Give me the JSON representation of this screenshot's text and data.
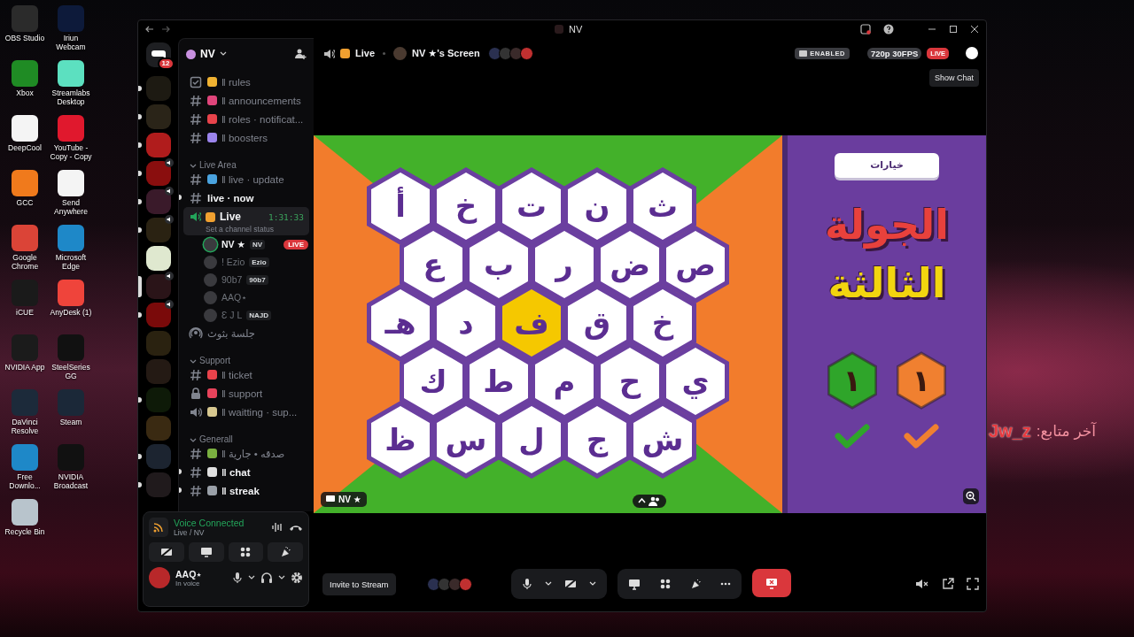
{
  "desktop": {
    "icons": [
      {
        "label": "OBS Studio",
        "color": "#2b2b2b"
      },
      {
        "label": "Iriun Webcam",
        "color": "#0d1a3a"
      },
      {
        "label": "Xbox",
        "color": "#1f8b24"
      },
      {
        "label": "Streamlabs Desktop",
        "color": "#5ce0c0"
      },
      {
        "label": "DeepCool",
        "color": "#f4f4f4"
      },
      {
        "label": "YouTube - Copy - Copy",
        "color": "#e0182d"
      },
      {
        "label": "GCC",
        "color": "#f07a1c"
      },
      {
        "label": "Send Anywhere",
        "color": "#f4f4f4"
      },
      {
        "label": "Google Chrome",
        "color": "#db4437"
      },
      {
        "label": "Microsoft Edge",
        "color": "#1e88c8"
      },
      {
        "label": "iCUE",
        "color": "#1a1a1a"
      },
      {
        "label": "AnyDesk (1)",
        "color": "#ef443b"
      },
      {
        "label": "NVIDIA App",
        "color": "#1b1b1b"
      },
      {
        "label": "SteelSeries GG",
        "color": "#111111"
      },
      {
        "label": "DaVinci Resolve",
        "color": "#1c2a3a"
      },
      {
        "label": "Steam",
        "color": "#1b2838"
      },
      {
        "label": "Free Downlo...",
        "color": "#1e88c8"
      },
      {
        "label": "NVIDIA Broadcast",
        "color": "#111111"
      },
      {
        "label": "Recycle Bin",
        "color": "#b8c4cc"
      }
    ],
    "follower_label": "آخر متابع:",
    "follower_name": "Jw_z"
  },
  "window": {
    "title": "NV"
  },
  "servers": {
    "home_badge": "12",
    "items": [
      {
        "color": "#1d1a12",
        "voice": false,
        "unread": true,
        "selected": false
      },
      {
        "color": "#2a2418",
        "voice": false,
        "unread": true,
        "selected": false
      },
      {
        "color": "#b01c1c",
        "voice": false,
        "unread": true,
        "selected": false
      },
      {
        "color": "#8a0e0e",
        "voice": true,
        "unread": true,
        "selected": false
      },
      {
        "color": "#3a1a2a",
        "voice": true,
        "unread": true,
        "selected": false
      },
      {
        "color": "#2a2212",
        "voice": true,
        "unread": true,
        "selected": false
      },
      {
        "color": "#dfe8cf",
        "voice": false,
        "unread": false,
        "selected": false
      },
      {
        "color": "#2a1418",
        "voice": true,
        "unread": false,
        "selected": true
      },
      {
        "color": "#7a0a0a",
        "voice": true,
        "unread": true,
        "selected": false
      },
      {
        "color": "#2a2210",
        "voice": false,
        "unread": false,
        "selected": false
      },
      {
        "color": "#241a14",
        "voice": false,
        "unread": false,
        "selected": false
      },
      {
        "color": "#0e1a08",
        "voice": false,
        "unread": true,
        "selected": false
      },
      {
        "color": "#3a2a12",
        "voice": false,
        "unread": false,
        "selected": false
      },
      {
        "color": "#1c2430",
        "voice": false,
        "unread": true,
        "selected": false
      },
      {
        "color": "#201a1c",
        "voice": false,
        "unread": true,
        "selected": false
      }
    ]
  },
  "sidebar": {
    "server_name": "NV",
    "channels": [
      {
        "kind": "rules",
        "color": "#f0b232",
        "name": "‖ rules",
        "unread": false
      },
      {
        "kind": "text",
        "color": "#e0457b",
        "name": "‖ announcements",
        "unread": false
      },
      {
        "kind": "text",
        "color": "#e8434b",
        "name": "‖ roles · notificat...",
        "unread": false
      },
      {
        "kind": "text",
        "color": "#9b84ec",
        "name": "‖ boosters",
        "unread": false
      },
      {
        "kind": "category",
        "name": "Live Area"
      },
      {
        "kind": "text",
        "color": "#4aa3df",
        "name": "‖ live · update",
        "unread": false
      },
      {
        "kind": "text",
        "name": "live · now",
        "unread": true
      },
      {
        "kind": "voice_live",
        "color": "#f0a030",
        "name": "Live",
        "timer": "1:31:33",
        "status_hint": "Set a channel status",
        "selected": true,
        "members": [
          {
            "name": "NV ★",
            "tag": "NV",
            "badge": "LIVE",
            "speaking": true
          },
          {
            "name": "! Ezio",
            "tag": "Ezio",
            "speaking": false
          },
          {
            "name": "90b7",
            "tag": "90b7",
            "speaking": false
          },
          {
            "name": "AAQ⋆",
            "speaking": false
          },
          {
            "name": "Ɛ J L",
            "tag": "NAJD",
            "speaking": false
          }
        ]
      },
      {
        "kind": "stage",
        "name": "جلسة بثوث",
        "unread": false
      },
      {
        "kind": "category",
        "name": "Support"
      },
      {
        "kind": "text",
        "color": "#e8434b",
        "name": "‖ ticket",
        "unread": false
      },
      {
        "kind": "locked",
        "color": "#e8435b",
        "name": "‖ support",
        "unread": false
      },
      {
        "kind": "voice",
        "color": "#d8c890",
        "name": "‖ waitting · sup...",
        "unread": false
      },
      {
        "kind": "category",
        "name": "Generall"
      },
      {
        "kind": "text",
        "color": "#7ab040",
        "name": "‖ صدقه • جارية",
        "unread": false
      },
      {
        "kind": "text",
        "color": "#e0e0e0",
        "name": "‖ chat",
        "unread": true
      },
      {
        "kind": "text",
        "color": "#9aa0a8",
        "name": "‖ streak",
        "unread": true
      }
    ]
  },
  "voice_panel": {
    "status": "Voice Connected",
    "location": "Live / NV",
    "user_name": "AAQ⋆",
    "user_status": "In voice"
  },
  "stream_header": {
    "channel": "Live",
    "screen_title": "NV ★'s Screen",
    "badge": "ENABLED",
    "quality": "720p 30FPS",
    "live": "LIVE",
    "tooltip": "Show Chat"
  },
  "stream": {
    "presenter": "NV ★",
    "tiles": [
      [
        {
          "letter": "ث",
          "highlighted": false
        },
        {
          "letter": "ن",
          "highlighted": false
        },
        {
          "letter": "ت",
          "highlighted": false
        },
        {
          "letter": "خ",
          "highlighted": false
        },
        {
          "letter": "أ",
          "highlighted": false
        }
      ],
      [
        {
          "letter": "ص",
          "highlighted": false
        },
        {
          "letter": "ض",
          "highlighted": false
        },
        {
          "letter": "ر",
          "highlighted": false
        },
        {
          "letter": "ب",
          "highlighted": false
        },
        {
          "letter": "ع",
          "highlighted": false
        }
      ],
      [
        {
          "letter": "خ",
          "highlighted": false
        },
        {
          "letter": "ق",
          "highlighted": false
        },
        {
          "letter": "ف",
          "highlighted": true
        },
        {
          "letter": "د",
          "highlighted": false
        },
        {
          "letter": "هـ",
          "highlighted": false
        }
      ],
      [
        {
          "letter": "ي",
          "highlighted": false
        },
        {
          "letter": "ح",
          "highlighted": false
        },
        {
          "letter": "م",
          "highlighted": false
        },
        {
          "letter": "ط",
          "highlighted": false
        },
        {
          "letter": "ك",
          "highlighted": false
        }
      ],
      [
        {
          "letter": "ش",
          "highlighted": false
        },
        {
          "letter": "ج",
          "highlighted": false
        },
        {
          "letter": "ل",
          "highlighted": false
        },
        {
          "letter": "س",
          "highlighted": false
        },
        {
          "letter": "ظ",
          "highlighted": false
        }
      ]
    ],
    "participants_expanded": false,
    "options_button": "خيارات",
    "round_title": [
      {
        "text": "الجولة",
        "color": "#e8413c"
      },
      {
        "text": "الثالثة",
        "color": "#f2d50f"
      }
    ],
    "teams": [
      {
        "score": "١",
        "color": "#f08030"
      },
      {
        "score": "١",
        "color": "#2fa52a"
      }
    ]
  },
  "controls": {
    "invite": "Invite to Stream"
  }
}
